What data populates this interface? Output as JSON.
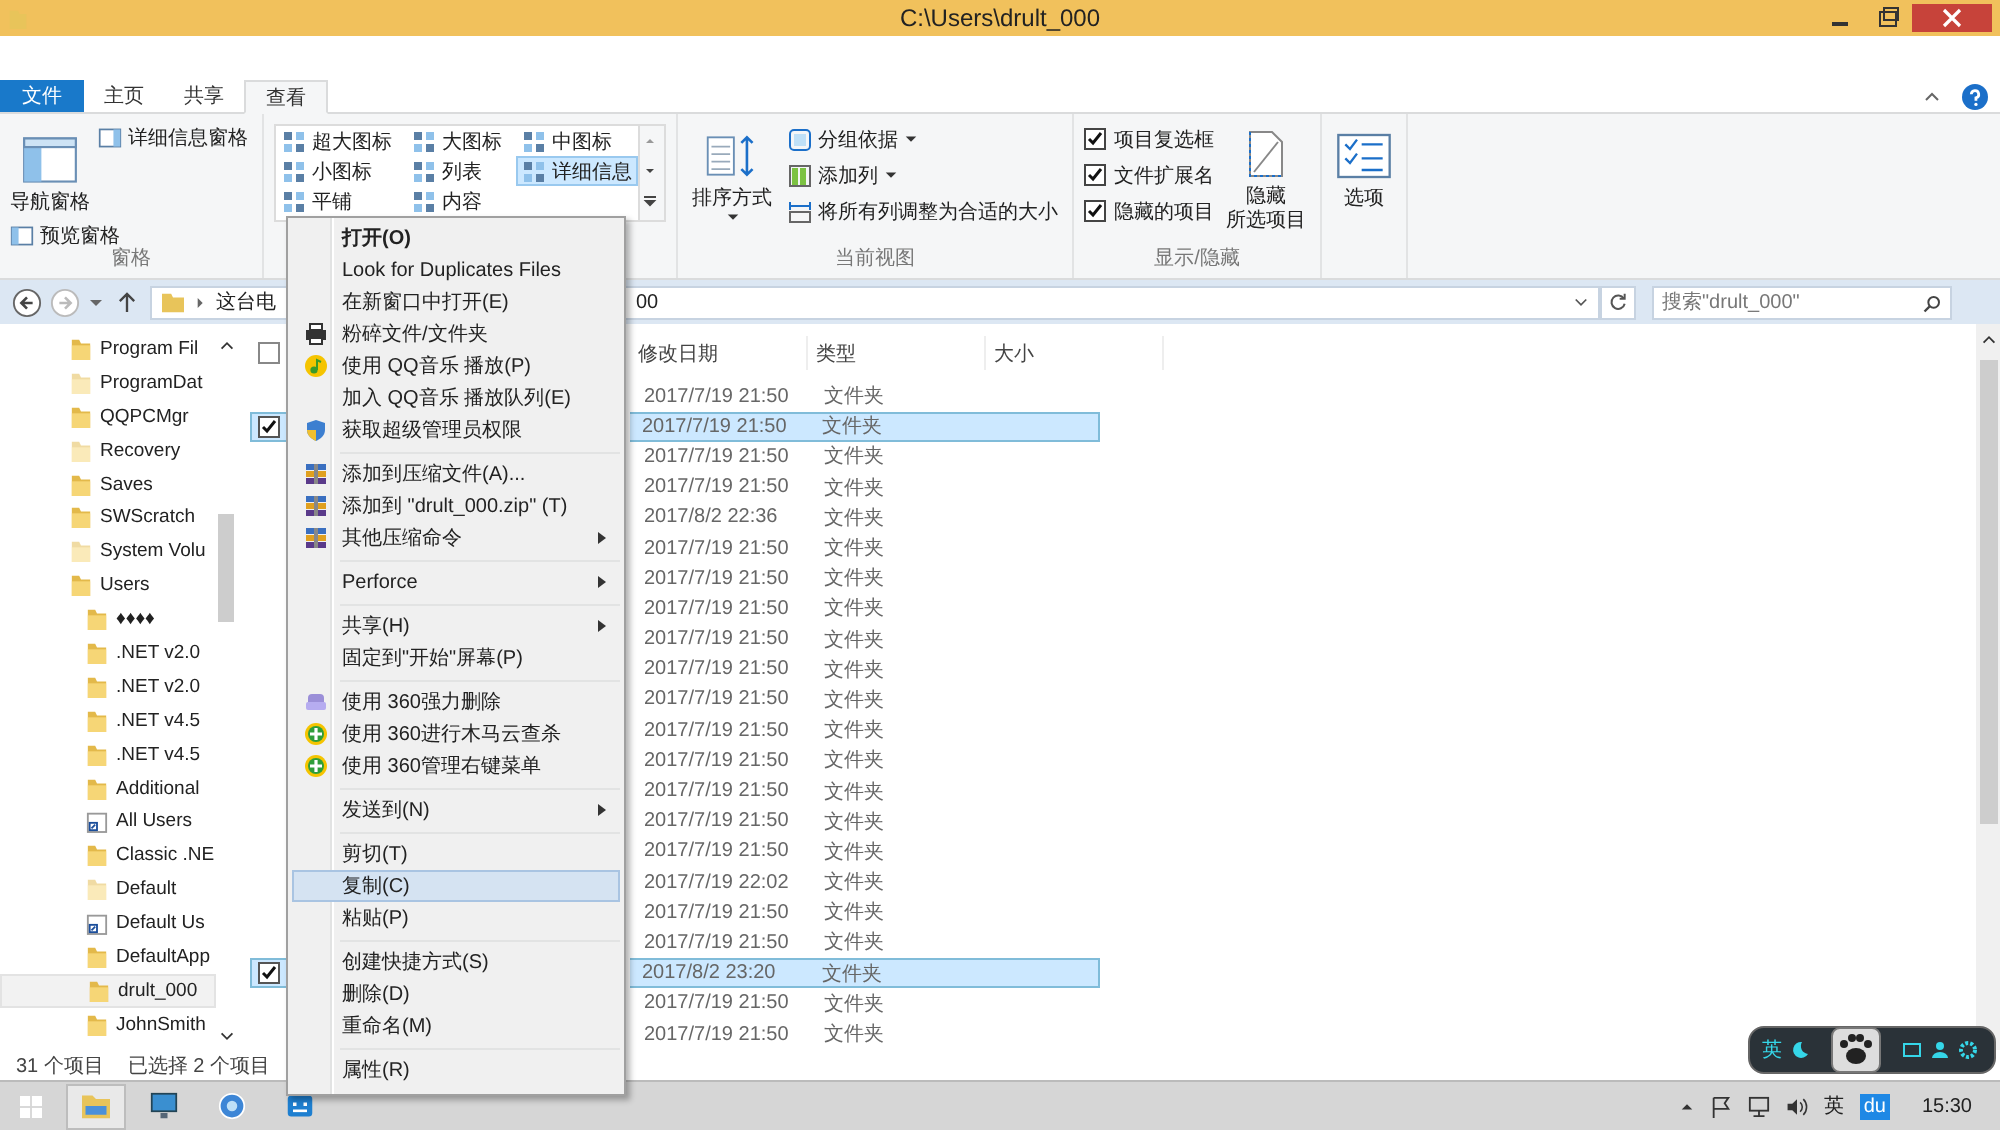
{
  "window": {
    "title": "C:\\Users\\drult_000"
  },
  "ribbon": {
    "tabs": [
      {
        "label": "文件",
        "kind": "file",
        "selected": false
      },
      {
        "label": "主页",
        "kind": "tab",
        "selected": false
      },
      {
        "label": "共享",
        "kind": "tab",
        "selected": false
      },
      {
        "label": "查看",
        "kind": "tab",
        "selected": true
      }
    ],
    "panes_group": {
      "label": "窗格",
      "navigation_pane": "导航窗格",
      "preview_pane": "预览窗格",
      "details_pane": "详细信息窗格"
    },
    "layout_group": {
      "options": [
        {
          "label": "超大图标",
          "selected": false
        },
        {
          "label": "大图标",
          "selected": false
        },
        {
          "label": "中图标",
          "selected": false
        },
        {
          "label": "小图标",
          "selected": false
        },
        {
          "label": "列表",
          "selected": false
        },
        {
          "label": "详细信息",
          "selected": true
        },
        {
          "label": "平铺",
          "selected": false
        },
        {
          "label": "内容",
          "selected": false
        }
      ]
    },
    "current_view_group": {
      "label": "当前视图",
      "sort_by": "排序方式",
      "group_by": "分组依据",
      "add_columns": "添加列",
      "size_all_columns": "将所有列调整为合适的大小"
    },
    "show_hide_group": {
      "label": "显示/隐藏",
      "checkboxes": [
        {
          "label": "项目复选框",
          "checked": true
        },
        {
          "label": "文件扩展名",
          "checked": true
        },
        {
          "label": "隐藏的项目",
          "checked": true
        }
      ],
      "hide_selected": [
        "隐藏",
        "所选项目"
      ]
    },
    "options_group": {
      "label": "选项"
    }
  },
  "address": {
    "segments": [
      "这台电",
      "00"
    ],
    "search_placeholder": "搜索\"drult_000\""
  },
  "tree": [
    {
      "label": "Program Fil",
      "kind": "folder",
      "selected": false
    },
    {
      "label": "ProgramDat",
      "kind": "hidden",
      "selected": false
    },
    {
      "label": "QQPCMgr",
      "kind": "folder",
      "selected": false
    },
    {
      "label": "Recovery",
      "kind": "hidden",
      "selected": false
    },
    {
      "label": "Saves",
      "kind": "folder",
      "selected": false
    },
    {
      "label": "SWScratch",
      "kind": "folder",
      "selected": false
    },
    {
      "label": "System Volu",
      "kind": "hidden",
      "selected": false
    },
    {
      "label": "Users",
      "kind": "folder",
      "selected": false,
      "children": [
        {
          "label": "♦♦♦♦",
          "kind": "folder",
          "selected": false
        },
        {
          "label": ".NET v2.0",
          "kind": "folder",
          "selected": false
        },
        {
          "label": ".NET v2.0",
          "kind": "folder",
          "selected": false
        },
        {
          "label": ".NET v4.5",
          "kind": "folder",
          "selected": false
        },
        {
          "label": ".NET v4.5",
          "kind": "folder",
          "selected": false
        },
        {
          "label": "Additional",
          "kind": "folder",
          "selected": false
        },
        {
          "label": "All Users",
          "kind": "shortcut",
          "selected": false
        },
        {
          "label": "Classic .NE",
          "kind": "folder",
          "selected": false
        },
        {
          "label": "Default",
          "kind": "hidden",
          "selected": false
        },
        {
          "label": "Default Us",
          "kind": "shortcut",
          "selected": false
        },
        {
          "label": "DefaultApp",
          "kind": "folder",
          "selected": false
        },
        {
          "label": "drult_000",
          "kind": "folder",
          "selected": true
        },
        {
          "label": "JohnSmith",
          "kind": "folder",
          "selected": false
        }
      ]
    }
  ],
  "file_list": {
    "select_all_checked": false,
    "columns": [
      "修改日期",
      "类型",
      "大小"
    ],
    "rows": [
      {
        "date": "2017/7/19 21:50",
        "type": "文件夹",
        "selected": false
      },
      {
        "date": "2017/7/19 21:50",
        "type": "文件夹",
        "selected": true
      },
      {
        "date": "2017/7/19 21:50",
        "type": "文件夹",
        "selected": false
      },
      {
        "date": "2017/7/19 21:50",
        "type": "文件夹",
        "selected": false
      },
      {
        "date": "2017/8/2 22:36",
        "type": "文件夹",
        "selected": false
      },
      {
        "date": "2017/7/19 21:50",
        "type": "文件夹",
        "selected": false
      },
      {
        "date": "2017/7/19 21:50",
        "type": "文件夹",
        "selected": false
      },
      {
        "date": "2017/7/19 21:50",
        "type": "文件夹",
        "selected": false
      },
      {
        "date": "2017/7/19 21:50",
        "type": "文件夹",
        "selected": false
      },
      {
        "date": "2017/7/19 21:50",
        "type": "文件夹",
        "selected": false
      },
      {
        "date": "2017/7/19 21:50",
        "type": "文件夹",
        "selected": false
      },
      {
        "date": "2017/7/19 21:50",
        "type": "文件夹",
        "selected": false
      },
      {
        "date": "2017/7/19 21:50",
        "type": "文件夹",
        "selected": false
      },
      {
        "date": "2017/7/19 21:50",
        "type": "文件夹",
        "selected": false
      },
      {
        "date": "2017/7/19 21:50",
        "type": "文件夹",
        "selected": false
      },
      {
        "date": "2017/7/19 21:50",
        "type": "文件夹",
        "selected": false
      },
      {
        "date": "2017/7/19 22:02",
        "type": "文件夹",
        "selected": false
      },
      {
        "date": "2017/7/19 21:50",
        "type": "文件夹",
        "selected": false
      },
      {
        "date": "2017/7/19 21:50",
        "type": "文件夹",
        "selected": false
      },
      {
        "date": "2017/8/2 23:20",
        "type": "文件夹",
        "selected": true
      },
      {
        "date": "2017/7/19 21:50",
        "type": "文件夹",
        "selected": false
      },
      {
        "date": "2017/7/19 21:50",
        "type": "文件夹",
        "selected": false
      }
    ]
  },
  "context_menu": [
    {
      "kind": "plain",
      "label": "打开(O)",
      "bold": true,
      "submenu": false,
      "selected": false
    },
    {
      "kind": "plain",
      "label": "Look for Duplicates Files",
      "bold": false,
      "submenu": false,
      "selected": false
    },
    {
      "kind": "plain",
      "label": "在新窗口中打开(E)",
      "bold": false,
      "submenu": false,
      "selected": false
    },
    {
      "kind": "printer",
      "label": "粉碎文件/文件夹",
      "bold": false,
      "submenu": false,
      "selected": false
    },
    {
      "kind": "music",
      "label": "使用 QQ音乐 播放(P)",
      "bold": false,
      "submenu": false,
      "selected": false
    },
    {
      "kind": "plain",
      "label": "加入 QQ音乐 播放队列(E)",
      "bold": false,
      "submenu": false,
      "selected": false
    },
    {
      "kind": "shield",
      "label": "获取超级管理员权限",
      "bold": false,
      "submenu": false,
      "selected": false
    },
    {
      "kind": "separator"
    },
    {
      "kind": "archive",
      "label": "添加到压缩文件(A)...",
      "bold": false,
      "submenu": false,
      "selected": false
    },
    {
      "kind": "archive",
      "label": "添加到 \"drult_000.zip\" (T)",
      "bold": false,
      "submenu": false,
      "selected": false
    },
    {
      "kind": "archive",
      "label": "其他压缩命令",
      "bold": false,
      "submenu": true,
      "selected": false
    },
    {
      "kind": "separator"
    },
    {
      "kind": "plain",
      "label": "Perforce",
      "bold": false,
      "submenu": true,
      "selected": false
    },
    {
      "kind": "separator"
    },
    {
      "kind": "plain",
      "label": "共享(H)",
      "bold": false,
      "submenu": true,
      "selected": false
    },
    {
      "kind": "plain",
      "label": "固定到\"开始\"屏幕(P)",
      "bold": false,
      "submenu": false,
      "selected": false
    },
    {
      "kind": "separator"
    },
    {
      "kind": "eraser",
      "label": "使用 360强力删除",
      "bold": false,
      "submenu": false,
      "selected": false
    },
    {
      "kind": "plus",
      "label": "使用 360进行木马云查杀",
      "bold": false,
      "submenu": false,
      "selected": false
    },
    {
      "kind": "plus",
      "label": "使用 360管理右键菜单",
      "bold": false,
      "submenu": false,
      "selected": false
    },
    {
      "kind": "separator"
    },
    {
      "kind": "plain",
      "label": "发送到(N)",
      "bold": false,
      "submenu": true,
      "selected": false
    },
    {
      "kind": "separator"
    },
    {
      "kind": "plain",
      "label": "剪切(T)",
      "bold": false,
      "submenu": false,
      "selected": false
    },
    {
      "kind": "plain",
      "label": "复制(C)",
      "bold": false,
      "submenu": false,
      "selected": true
    },
    {
      "kind": "plain",
      "label": "粘贴(P)",
      "bold": false,
      "submenu": false,
      "selected": false
    },
    {
      "kind": "separator"
    },
    {
      "kind": "plain",
      "label": "创建快捷方式(S)",
      "bold": false,
      "submenu": false,
      "selected": false
    },
    {
      "kind": "plain",
      "label": "删除(D)",
      "bold": false,
      "submenu": false,
      "selected": false
    },
    {
      "kind": "plain",
      "label": "重命名(M)",
      "bold": false,
      "submenu": false,
      "selected": false
    },
    {
      "kind": "separator"
    },
    {
      "kind": "plain",
      "label": "属性(R)",
      "bold": false,
      "submenu": false,
      "selected": false
    }
  ],
  "status_bar": {
    "item_count": "31 个项目",
    "selection": "已选择 2 个项目"
  },
  "ime_toolbar": {
    "label": "英"
  },
  "taskbar": {
    "apps": [
      {
        "kind": "explorer",
        "selected": true
      },
      {
        "kind": "monitor",
        "selected": false
      },
      {
        "kind": "globe",
        "selected": false
      },
      {
        "kind": "robot",
        "selected": false
      }
    ],
    "ime": "英",
    "du": "du",
    "time": "15:30"
  }
}
